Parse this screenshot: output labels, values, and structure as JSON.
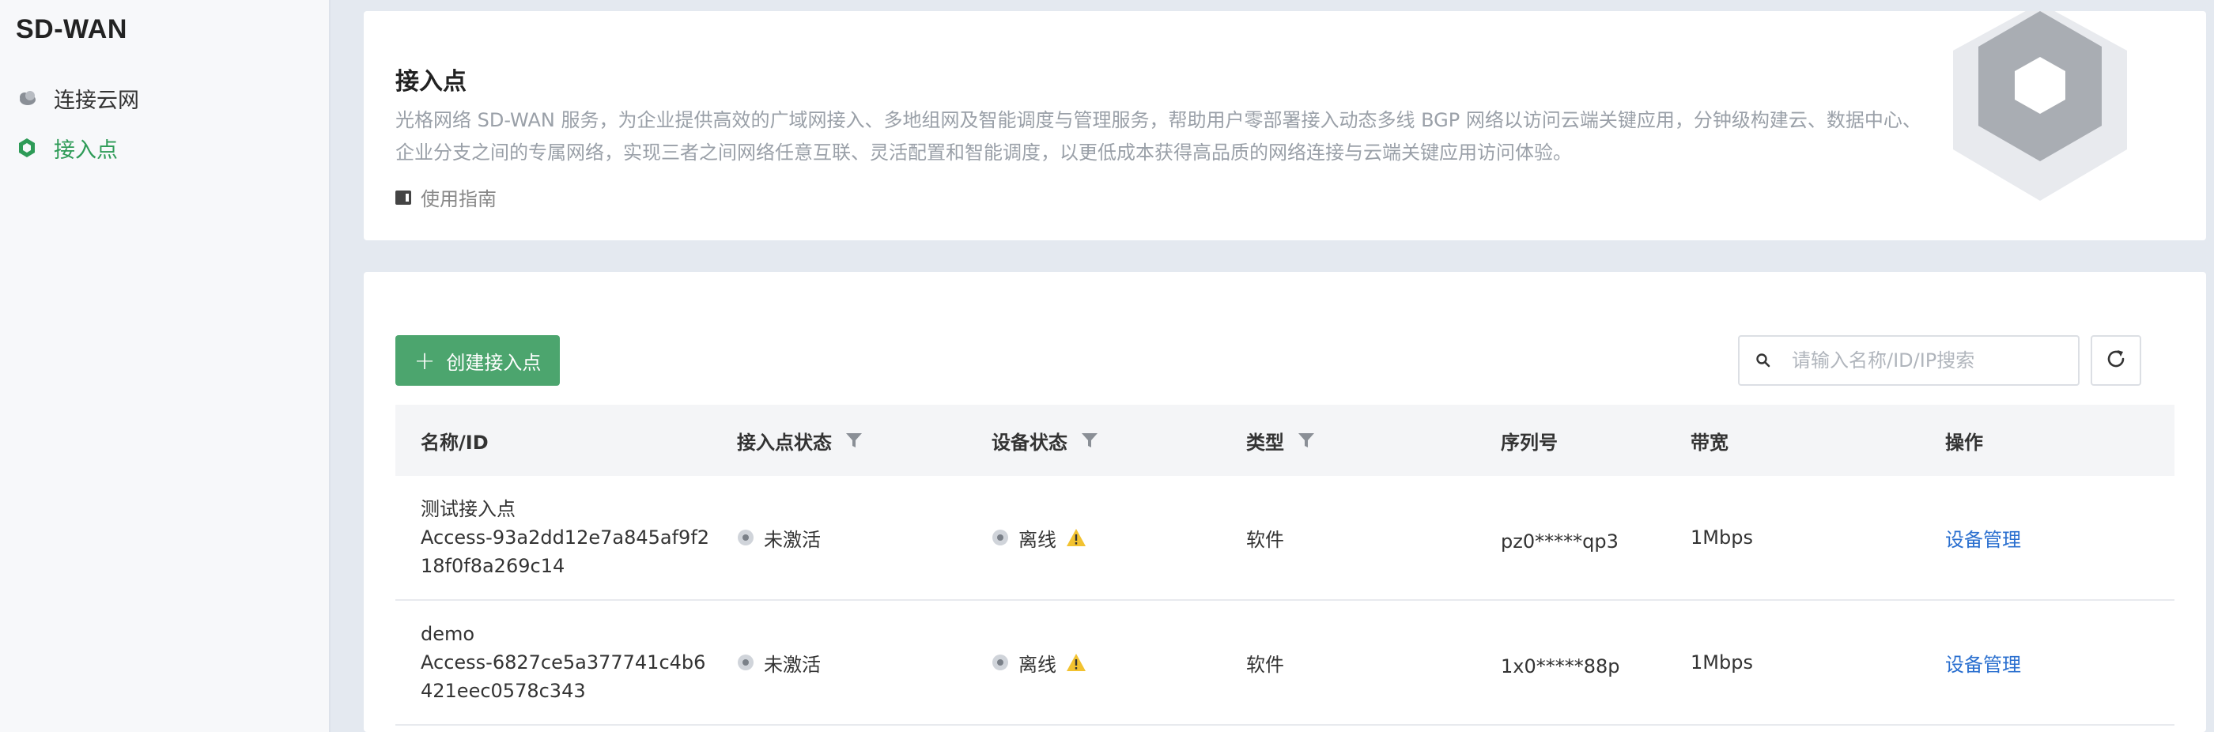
{
  "sidebar": {
    "title": "SD-WAN",
    "items": [
      {
        "label": "连接云网",
        "icon": "cloud-icon",
        "active": false
      },
      {
        "label": "接入点",
        "icon": "hexagon-icon",
        "active": true
      }
    ]
  },
  "intro": {
    "title": "接入点",
    "description": "光格网络 SD-WAN 服务，为企业提供高效的广域网接入、多地组网及智能调度与管理服务，帮助用户零部署接入动态多线 BGP 网络以访问云端关键应用，分钟级构建云、数据中心、企业分支之间的专属网络，实现三者之间网络任意互联、灵活配置和智能调度，以更低成本获得高品质的网络连接与云端关键应用访问体验。",
    "guide_label": "使用指南"
  },
  "toolbar": {
    "create_label": "创建接入点",
    "search_placeholder": "请输入名称/ID/IP搜索"
  },
  "table": {
    "headers": {
      "name": "名称/ID",
      "ap_status": "接入点状态",
      "device_status": "设备状态",
      "type": "类型",
      "serial": "序列号",
      "bandwidth": "带宽",
      "action": "操作"
    },
    "rows": [
      {
        "name": "测试接入点",
        "id_line1": "Access-93a2dd12e7a845af9f2",
        "id_line2": "18f0f8a269c14",
        "ap_status": "未激活",
        "device_status": "离线",
        "type": "软件",
        "serial": "pz0*****qp3",
        "bandwidth": "1Mbps",
        "action": "设备管理"
      },
      {
        "name": "demo",
        "id_line1": "Access-6827ce5a377741c4b6",
        "id_line2": "421eec0578c343",
        "ap_status": "未激活",
        "device_status": "离线",
        "type": "软件",
        "serial": "1x0*****88p",
        "bandwidth": "1Mbps",
        "action": "设备管理"
      }
    ]
  },
  "colors": {
    "accent_green": "#4ca56e",
    "link_blue": "#2a6fcf",
    "warning": "#f2c230"
  }
}
